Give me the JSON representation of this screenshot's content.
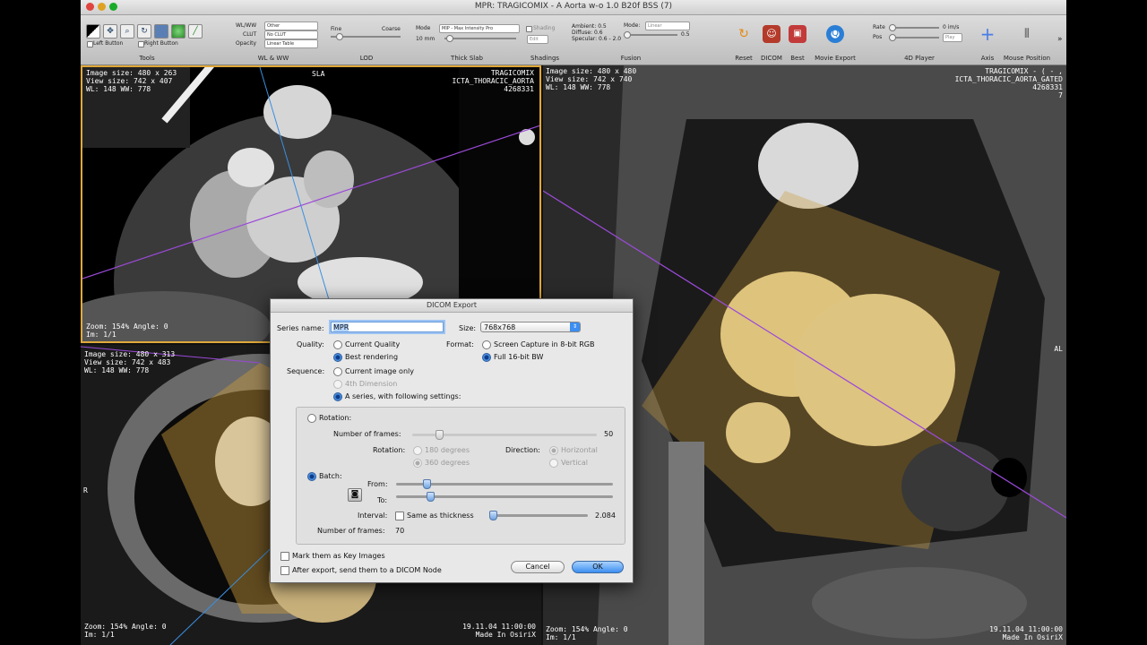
{
  "window": {
    "title": "MPR: TRAGICOMIX - A Aorta w-o  1.0  B20f  BSS (7)"
  },
  "toolbar": {
    "tools_label": "Tools",
    "left_button": "Left Button",
    "right_button": "Right Button",
    "wlww": {
      "label": "WL & WW",
      "wlww_key": "WL/WW",
      "wlww_val": "Other",
      "clut_key": "CLUT",
      "clut_val": "No CLUT",
      "opacity_key": "Opacity",
      "opacity_val": "Linear Table"
    },
    "lod": {
      "label": "LOD",
      "fine": "Fine",
      "coarse": "Coarse"
    },
    "thickslab": {
      "label": "Thick Slab",
      "mode_key": "Mode",
      "mode_val": "MIP - Max Intensity Pro",
      "value": "10 mm"
    },
    "shadings": {
      "label": "Shadings",
      "check": "Shading",
      "edit": "Edit"
    },
    "fusion": {
      "label": "Fusion",
      "ambient": "Ambient: 0.5",
      "diffuse": "Diffuse: 0.6",
      "specular": "Specular: 0.6 - 2.0",
      "mode_key": "Mode:",
      "mode_val": "Linear",
      "val": "0.5"
    },
    "reset": "Reset",
    "dicom": "DICOM",
    "best": "Best",
    "movie_export": "Movie Export",
    "player": {
      "label": "4D Player",
      "rate": "Rate",
      "rate_val": "0 im/s",
      "pos": "Pos",
      "play": "Play"
    },
    "axis": "Axis",
    "mouse_position": "Mouse Position"
  },
  "views": {
    "top_left": {
      "image_size": "Image size: 480 x 263",
      "view_size": "View size: 742 x 407",
      "wlww": "WL: 148 WW: 778",
      "zoom": "Zoom: 154%  Angle: 0",
      "im": "Im: 1/1",
      "orient_top": "SLA",
      "patient": "TRAGICOMIX",
      "study": "ICTA_THORACIC_AORTA",
      "id": "4268331"
    },
    "right": {
      "image_size": "Image size: 480 x 480",
      "view_size": "View size: 742 x 740",
      "wlww": "WL: 148 WW: 778",
      "patient": "TRAGICOMIX - ( - ,",
      "study": "ICTA_THORACIC_AORTA_GATED",
      "id": "4268331",
      "num": "7",
      "orient_right": "AL",
      "zoom": "Zoom: 154%  Angle: 0",
      "im": "Im: 1/1",
      "datetime": "19.11.04 11:00:00",
      "made": "Made In OsiriX"
    },
    "bottom_left": {
      "image_size": "Image size: 480 x 313",
      "view_size": "View size: 742 x 483",
      "wlww": "WL: 148 WW: 778",
      "orient_left": "R",
      "zoom": "Zoom: 154%  Angle: 0",
      "im": "Im: 1/1",
      "datetime": "19.11.04 11:00:00",
      "made": "Made In OsiriX"
    }
  },
  "dialog": {
    "title": "DICOM Export",
    "series_name_label": "Series name:",
    "series_name_value": "MPR",
    "size_label": "Size:",
    "size_value": "768x768",
    "quality_label": "Quality:",
    "quality_current": "Current Quality",
    "quality_best": "Best rendering",
    "format_label": "Format:",
    "format_screen": "Screen Capture in 8-bit RGB",
    "format_full": "Full 16-bit BW",
    "sequence_label": "Sequence:",
    "seq_current": "Current image only",
    "seq_4d": "4th Dimension",
    "seq_series": "A series, with following settings:",
    "rotation_label": "Rotation:",
    "frames_label": "Number of frames:",
    "frames_value": "50",
    "rotation_sub": "Rotation:",
    "deg180": "180 degrees",
    "deg360": "360 degrees",
    "direction_label": "Direction:",
    "horizontal": "Horizontal",
    "vertical": "Vertical",
    "batch_label": "Batch:",
    "from_label": "From:",
    "to_label": "To:",
    "interval_label": "Interval:",
    "same_thickness": "Same as thickness",
    "interval_value": "2.084",
    "batch_frames_label": "Number of frames:",
    "batch_frames_value": "70",
    "key_images": "Mark them as Key Images",
    "send_node": "After export, send them to a DICOM Node",
    "cancel": "Cancel",
    "ok": "OK"
  }
}
